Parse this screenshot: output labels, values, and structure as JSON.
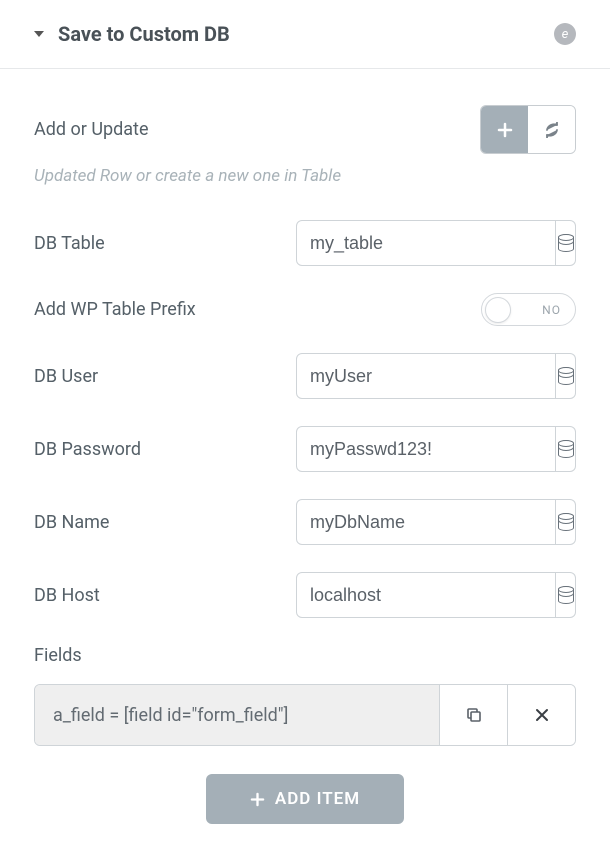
{
  "header": {
    "title": "Save to Custom DB",
    "badge": "e"
  },
  "mode": {
    "label": "Add or Update",
    "helper": "Updated Row or create a new one in Table"
  },
  "fields": {
    "db_table": {
      "label": "DB Table",
      "value": "my_table"
    },
    "prefix": {
      "label": "Add WP Table Prefix",
      "state": "NO"
    },
    "db_user": {
      "label": "DB User",
      "value": "myUser"
    },
    "db_password": {
      "label": "DB Password",
      "value": "myPasswd123!"
    },
    "db_name": {
      "label": "DB Name",
      "value": "myDbName"
    },
    "db_host": {
      "label": "DB Host",
      "value": "localhost"
    }
  },
  "items": {
    "section_label": "Fields",
    "list": [
      {
        "text": "a_field = [field id=\"form_field\"]"
      }
    ],
    "add_button": "ADD ITEM"
  }
}
